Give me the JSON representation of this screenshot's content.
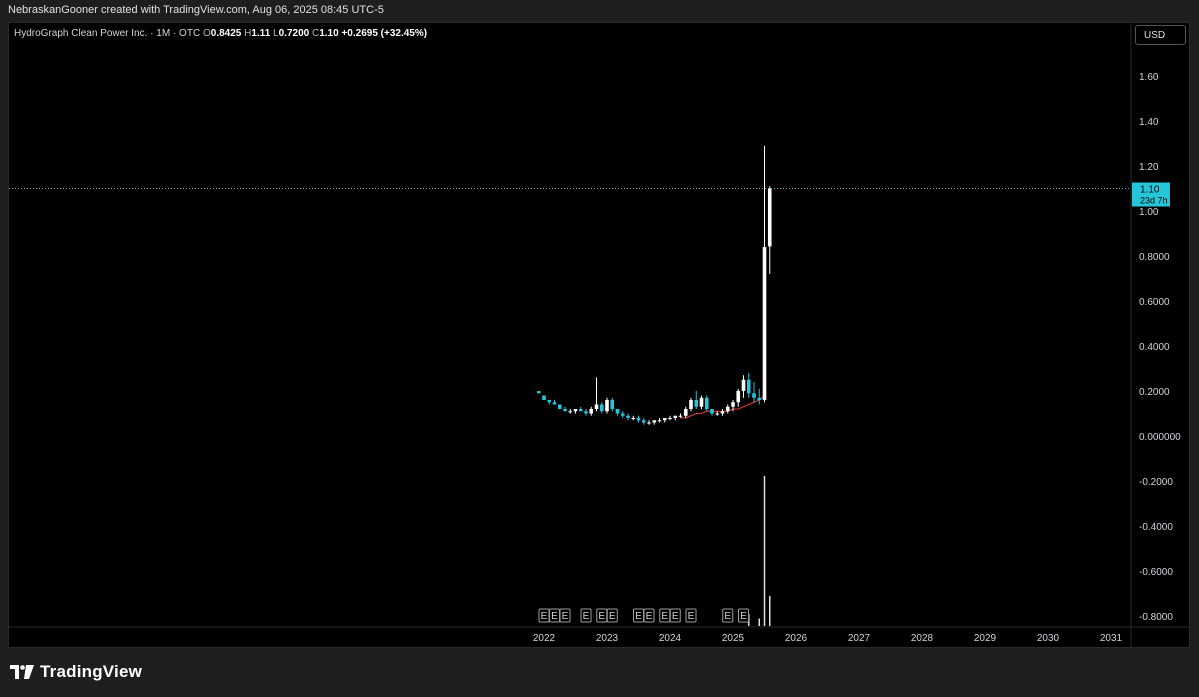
{
  "header": {
    "caption": "NebraskanGooner created with TradingView.com, Aug 06, 2025 08:45 UTC-5"
  },
  "legend": {
    "symbol": "HydroGraph Clean Power Inc. · 1M · OTC",
    "o_label": "O",
    "o_value": "0.8425",
    "h_label": "H",
    "h_value": "1.11",
    "l_label": "L",
    "l_value": "0.7200",
    "c_label": "C",
    "c_value": "1.10",
    "change": "+0.2695 (+32.45%)"
  },
  "currency_button": "USD",
  "price_tag": {
    "price": "1.10",
    "countdown": "23d 7h"
  },
  "footer": {
    "brand": "TradingView"
  },
  "colors": {
    "up": "#ffffff",
    "down": "#26c6da",
    "ma": "#e53935",
    "price_tag_bg": "#26c6da",
    "dotted_line": "#6fa8b8"
  },
  "chart_data": {
    "type": "candlestick",
    "title": "HydroGraph Clean Power Inc. · 1M · OTC",
    "y_ticks": [
      "1.60",
      "1.40",
      "1.20",
      "1.00",
      "0.8000",
      "0.6000",
      "0.4000",
      "0.2000",
      "0.000000",
      "-0.2000",
      "-0.4000",
      "-0.6000",
      "-0.8000"
    ],
    "y_tick_values": [
      1.6,
      1.4,
      1.2,
      1.0,
      0.8,
      0.6,
      0.4,
      0.2,
      0.0,
      -0.2,
      -0.4,
      -0.6,
      -0.8
    ],
    "x_ticks": [
      "2022",
      "2023",
      "2024",
      "2025",
      "2026",
      "2027",
      "2028",
      "2029",
      "2030",
      "2031"
    ],
    "current_price": 1.1,
    "dates": [
      "2021-12",
      "2022-01",
      "2022-02",
      "2022-03",
      "2022-04",
      "2022-05",
      "2022-06",
      "2022-07",
      "2022-08",
      "2022-09",
      "2022-10",
      "2022-11",
      "2022-12",
      "2023-01",
      "2023-02",
      "2023-03",
      "2023-04",
      "2023-05",
      "2023-06",
      "2023-07",
      "2023-08",
      "2023-09",
      "2023-10",
      "2023-11",
      "2023-12",
      "2024-01",
      "2024-02",
      "2024-03",
      "2024-04",
      "2024-05",
      "2024-06",
      "2024-07",
      "2024-08",
      "2024-09",
      "2024-10",
      "2024-11",
      "2024-12",
      "2025-01",
      "2025-02",
      "2025-03",
      "2025-04",
      "2025-05",
      "2025-06",
      "2025-07",
      "2025-08"
    ],
    "ohlc": [
      [
        0.2,
        0.2,
        0.19,
        0.19
      ],
      [
        0.18,
        0.18,
        0.16,
        0.16
      ],
      [
        0.16,
        0.16,
        0.14,
        0.15
      ],
      [
        0.15,
        0.16,
        0.14,
        0.14
      ],
      [
        0.14,
        0.14,
        0.12,
        0.12
      ],
      [
        0.12,
        0.13,
        0.11,
        0.11
      ],
      [
        0.11,
        0.12,
        0.1,
        0.11
      ],
      [
        0.11,
        0.12,
        0.1,
        0.12
      ],
      [
        0.12,
        0.13,
        0.11,
        0.11
      ],
      [
        0.11,
        0.12,
        0.09,
        0.1
      ],
      [
        0.1,
        0.13,
        0.09,
        0.12
      ],
      [
        0.12,
        0.26,
        0.11,
        0.14
      ],
      [
        0.14,
        0.15,
        0.1,
        0.11
      ],
      [
        0.11,
        0.17,
        0.1,
        0.16
      ],
      [
        0.16,
        0.17,
        0.11,
        0.12
      ],
      [
        0.12,
        0.12,
        0.09,
        0.1
      ],
      [
        0.1,
        0.11,
        0.08,
        0.09
      ],
      [
        0.09,
        0.1,
        0.07,
        0.08
      ],
      [
        0.08,
        0.09,
        0.07,
        0.08
      ],
      [
        0.08,
        0.09,
        0.06,
        0.07
      ],
      [
        0.07,
        0.08,
        0.05,
        0.06
      ],
      [
        0.06,
        0.07,
        0.05,
        0.06
      ],
      [
        0.06,
        0.07,
        0.05,
        0.07
      ],
      [
        0.07,
        0.08,
        0.06,
        0.07
      ],
      [
        0.07,
        0.08,
        0.06,
        0.08
      ],
      [
        0.08,
        0.09,
        0.07,
        0.08
      ],
      [
        0.08,
        0.09,
        0.07,
        0.09
      ],
      [
        0.09,
        0.1,
        0.08,
        0.09
      ],
      [
        0.09,
        0.13,
        0.08,
        0.12
      ],
      [
        0.12,
        0.17,
        0.11,
        0.16
      ],
      [
        0.16,
        0.2,
        0.12,
        0.13
      ],
      [
        0.13,
        0.18,
        0.12,
        0.17
      ],
      [
        0.17,
        0.18,
        0.11,
        0.12
      ],
      [
        0.12,
        0.12,
        0.09,
        0.1
      ],
      [
        0.1,
        0.11,
        0.09,
        0.1
      ],
      [
        0.1,
        0.12,
        0.09,
        0.11
      ],
      [
        0.11,
        0.14,
        0.1,
        0.13
      ],
      [
        0.13,
        0.16,
        0.11,
        0.15
      ],
      [
        0.15,
        0.21,
        0.13,
        0.2
      ],
      [
        0.2,
        0.27,
        0.17,
        0.25
      ],
      [
        0.25,
        0.28,
        0.17,
        0.19
      ],
      [
        0.19,
        0.24,
        0.15,
        0.17
      ],
      [
        0.17,
        0.21,
        0.14,
        0.16
      ],
      [
        0.16,
        1.29,
        0.15,
        0.84
      ],
      [
        0.8425,
        1.11,
        0.72,
        1.1
      ]
    ],
    "moving_average": {
      "dates": [
        "2024-03",
        "2024-04",
        "2024-05",
        "2024-06",
        "2024-07",
        "2024-08",
        "2024-09",
        "2024-10",
        "2024-11",
        "2024-12",
        "2025-01",
        "2025-02",
        "2025-03",
        "2025-04",
        "2025-05",
        "2025-06",
        "2025-07"
      ],
      "values": [
        0.08,
        0.08,
        0.09,
        0.1,
        0.1,
        0.11,
        0.11,
        0.11,
        0.11,
        0.11,
        0.12,
        0.12,
        0.13,
        0.14,
        0.15,
        0.16,
        0.18
      ]
    },
    "volume": {
      "note": "relative volume bars",
      "dates": [
        "2025-04",
        "2025-06",
        "2025-07",
        "2025-08"
      ],
      "values": [
        0.08,
        0.05,
        1.0,
        0.2
      ]
    },
    "event_markers": {
      "label": "E",
      "dates": [
        "2022-01",
        "2022-03",
        "2022-05",
        "2022-09",
        "2022-12",
        "2023-02",
        "2023-07",
        "2023-09",
        "2023-12",
        "2024-02",
        "2024-05",
        "2024-12",
        "2025-03"
      ]
    },
    "grid": false,
    "legend_position": "top-left"
  }
}
